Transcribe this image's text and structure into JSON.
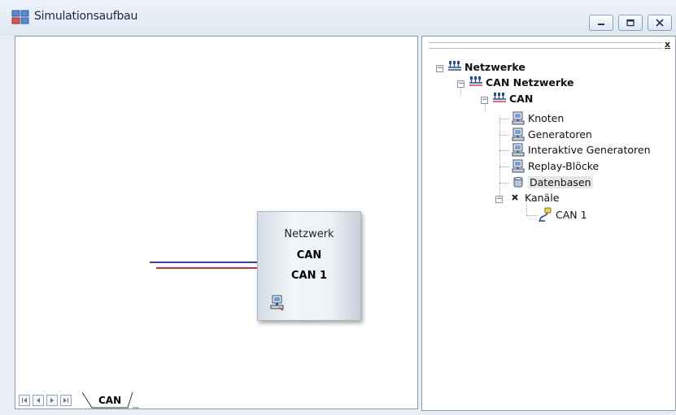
{
  "window": {
    "title": "Simulationsaufbau",
    "minimize_icon": "minimize-icon",
    "restore_icon": "restore-icon",
    "close_icon": "close-icon"
  },
  "canvas": {
    "network_box": {
      "type_label": "Netzwerk",
      "bus_label": "CAN",
      "channel_label": "CAN 1",
      "icon": "network-node-icon"
    },
    "bus_line_colors": [
      "#3a3fb0",
      "#c8304a"
    ]
  },
  "tabs": {
    "active": "CAN",
    "nav_icons": [
      "first-page-icon",
      "prev-page-icon",
      "next-page-icon",
      "last-page-icon"
    ]
  },
  "tree": {
    "close_label": "x",
    "items": [
      {
        "label": "Netzwerke",
        "level": 0,
        "bold": true,
        "icon": "network-icon",
        "expanded": true
      },
      {
        "label": "CAN Netzwerke",
        "level": 1,
        "bold": true,
        "icon": "network-icon",
        "expanded": true
      },
      {
        "label": "CAN",
        "level": 2,
        "bold": true,
        "icon": "network-icon",
        "expanded": true
      },
      {
        "label": "Knoten",
        "level": 3,
        "icon": "computer-node-icon"
      },
      {
        "label": "Generatoren",
        "level": 3,
        "icon": "computer-node-icon"
      },
      {
        "label": "Interaktive Generatoren",
        "level": 3,
        "icon": "computer-node-icon"
      },
      {
        "label": "Replay-Blöcke",
        "level": 3,
        "icon": "computer-node-icon"
      },
      {
        "label": "Datenbasen",
        "level": 3,
        "icon": "database-icon",
        "selected": true
      },
      {
        "label": "Kanäle",
        "level": 3,
        "icon": "channel-icon",
        "expanded": true
      },
      {
        "label": "CAN 1",
        "level": 4,
        "icon": "can-channel-icon"
      }
    ]
  }
}
